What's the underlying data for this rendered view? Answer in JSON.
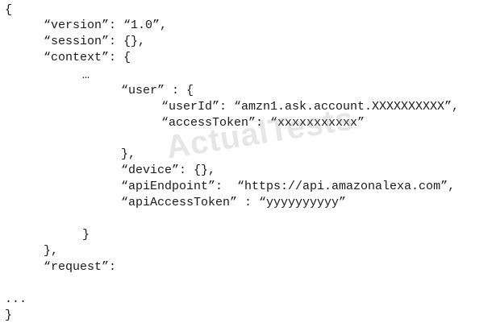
{
  "watermark": "ActualTests",
  "lines": [
    "{",
    "“version”: “1.0”,",
    "“session”: {},",
    "“context”: {",
    "…",
    "“user” : {",
    "“userId”: “amzn1.ask.account.XXXXXXXXXX”,",
    "“accessToken”: “xxxxxxxxxxx”",
    "},",
    "“device”: {},",
    "“apiEndpoint”:  “https://api.amazonalexa.com”,",
    "“apiAccessToken” : “yyyyyyyyyy”",
    "}",
    "},",
    "“request”:",
    "...",
    "}"
  ]
}
